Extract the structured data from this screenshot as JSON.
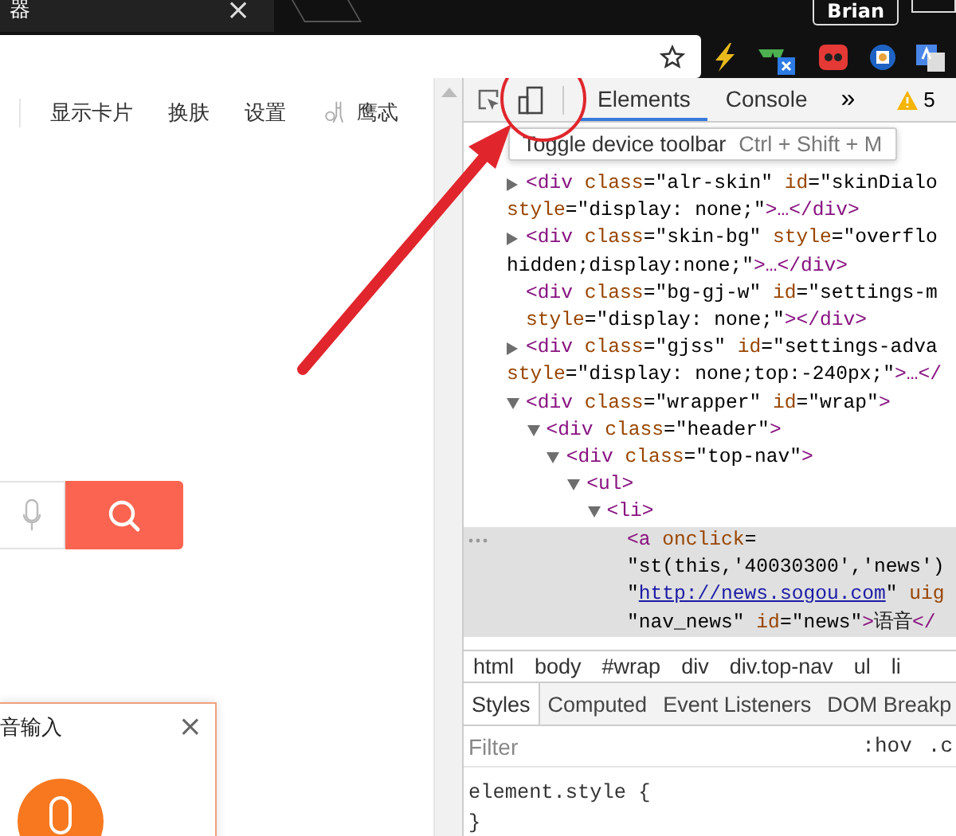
{
  "browser": {
    "tab_title": "器",
    "tab_close": "×",
    "profile_name": "Brian"
  },
  "page": {
    "nav": [
      "显示卡片",
      "换肤",
      "设置",
      "鹰忒"
    ],
    "voice_popup": {
      "title": "音输入",
      "close": "×"
    }
  },
  "devtools": {
    "tabs": [
      {
        "label": "Elements",
        "selected": true
      },
      {
        "label": "Console",
        "selected": false
      }
    ],
    "more": "»",
    "warning_count": "5",
    "tooltip": {
      "label": "Toggle device toolbar",
      "shortcut": "Ctrl + Shift + M"
    },
    "dom_tree": [
      {
        "expanded": false,
        "selected": false,
        "lines": [
          [
            {
              "kind": "tag",
              "text": "<div"
            },
            {
              "kind": "attr",
              "text": " class"
            },
            {
              "kind": "punct",
              "text": "="
            },
            {
              "kind": "value",
              "text": "\"alr-skin\""
            },
            {
              "kind": "attr",
              "text": " id"
            },
            {
              "kind": "punct",
              "text": "="
            },
            {
              "kind": "value",
              "text": "\"skinDialo"
            }
          ],
          [
            {
              "kind": "attr",
              "text": "style"
            },
            {
              "kind": "punct",
              "text": "="
            },
            {
              "kind": "value",
              "text": "\"display: none;\""
            },
            {
              "kind": "tag",
              "text": ">…</div>"
            }
          ]
        ]
      },
      {
        "expanded": false,
        "selected": false,
        "lines": [
          [
            {
              "kind": "tag",
              "text": "<div"
            },
            {
              "kind": "attr",
              "text": " class"
            },
            {
              "kind": "punct",
              "text": "="
            },
            {
              "kind": "value",
              "text": "\"skin-bg\""
            },
            {
              "kind": "attr",
              "text": " style"
            },
            {
              "kind": "punct",
              "text": "="
            },
            {
              "kind": "value",
              "text": "\"overflo"
            }
          ],
          [
            {
              "kind": "value",
              "text": "hidden;display:none;\""
            },
            {
              "kind": "tag",
              "text": ">…</div>"
            }
          ]
        ]
      },
      {
        "selected": false,
        "lines": [
          [
            {
              "kind": "tag",
              "text": "<div"
            },
            {
              "kind": "attr",
              "text": " class"
            },
            {
              "kind": "punct",
              "text": "="
            },
            {
              "kind": "value",
              "text": "\"bg-gj-w\""
            },
            {
              "kind": "attr",
              "text": " id"
            },
            {
              "kind": "punct",
              "text": "="
            },
            {
              "kind": "value",
              "text": "\"settings-m"
            }
          ],
          [
            {
              "kind": "attr",
              "text": "style"
            },
            {
              "kind": "punct",
              "text": "="
            },
            {
              "kind": "value",
              "text": "\"display: none;\""
            },
            {
              "kind": "tag",
              "text": "></div>"
            }
          ]
        ]
      },
      {
        "expanded": false,
        "selected": false,
        "lines": [
          [
            {
              "kind": "tag",
              "text": "<div"
            },
            {
              "kind": "attr",
              "text": " class"
            },
            {
              "kind": "punct",
              "text": "="
            },
            {
              "kind": "value",
              "text": "\"gjss\""
            },
            {
              "kind": "attr",
              "text": " id"
            },
            {
              "kind": "punct",
              "text": "="
            },
            {
              "kind": "value",
              "text": "\"settings-adva"
            }
          ],
          [
            {
              "kind": "attr",
              "text": "style"
            },
            {
              "kind": "punct",
              "text": "="
            },
            {
              "kind": "value",
              "text": "\"display: none;top:-240px;\""
            },
            {
              "kind": "tag",
              "text": ">…</"
            }
          ]
        ]
      },
      {
        "expanded": true,
        "selected": false,
        "lines": [
          [
            {
              "kind": "tag",
              "text": "<div"
            },
            {
              "kind": "attr",
              "text": " class"
            },
            {
              "kind": "punct",
              "text": "="
            },
            {
              "kind": "value",
              "text": "\"wrapper\""
            },
            {
              "kind": "attr",
              "text": " id"
            },
            {
              "kind": "punct",
              "text": "="
            },
            {
              "kind": "value",
              "text": "\"wrap\""
            },
            {
              "kind": "tag",
              "text": ">"
            }
          ]
        ],
        "children": [
          {
            "expanded": true,
            "selected": false,
            "lines": [
              [
                {
                  "kind": "tag",
                  "text": "<div"
                },
                {
                  "kind": "attr",
                  "text": " class"
                },
                {
                  "kind": "punct",
                  "text": "="
                },
                {
                  "kind": "value",
                  "text": "\"header\""
                },
                {
                  "kind": "tag",
                  "text": ">"
                }
              ]
            ],
            "children": [
              {
                "expanded": true,
                "selected": false,
                "lines": [
                  [
                    {
                      "kind": "tag",
                      "text": "<div"
                    },
                    {
                      "kind": "attr",
                      "text": " class"
                    },
                    {
                      "kind": "punct",
                      "text": "="
                    },
                    {
                      "kind": "value",
                      "text": "\"top-nav\""
                    },
                    {
                      "kind": "tag",
                      "text": ">"
                    }
                  ]
                ],
                "children": [
                  {
                    "expanded": true,
                    "selected": false,
                    "lines": [
                      [
                        {
                          "kind": "tag",
                          "text": "<ul>"
                        }
                      ]
                    ],
                    "children": [
                      {
                        "expanded": true,
                        "selected": false,
                        "lines": [
                          [
                            {
                              "kind": "tag",
                              "text": "<li>"
                            }
                          ]
                        ],
                        "children": [
                          {
                            "selected": true,
                            "lines": [
                              [
                                {
                                  "kind": "tag",
                                  "text": "<a"
                                },
                                {
                                  "kind": "attr",
                                  "text": " onclick"
                                },
                                {
                                  "kind": "punct",
                                  "text": "="
                                }
                              ],
                              [
                                {
                                  "kind": "value",
                                  "text": "\"st(this,'40030300','news')"
                                }
                              ],
                              [
                                {
                                  "kind": "value",
                                  "text": "\""
                                },
                                {
                                  "kind": "link",
                                  "text": "http://news.sogou.com"
                                },
                                {
                                  "kind": "value",
                                  "text": "\""
                                },
                                {
                                  "kind": "attr",
                                  "text": " uig"
                                }
                              ],
                              [
                                {
                                  "kind": "value",
                                  "text": "\"nav_news\""
                                },
                                {
                                  "kind": "attr",
                                  "text": " id"
                                },
                                {
                                  "kind": "punct",
                                  "text": "="
                                },
                                {
                                  "kind": "value",
                                  "text": "\"news\""
                                },
                                {
                                  "kind": "tag",
                                  "text": ">"
                                },
                                {
                                  "kind": "content",
                                  "text": "语音"
                                },
                                {
                                  "kind": "tag",
                                  "text": "</"
                                }
                              ]
                            ]
                          }
                        ]
                      }
                    ]
                  }
                ]
              }
            ]
          }
        ]
      }
    ],
    "breadcrumbs": [
      {
        "label": "html"
      },
      {
        "label": "body"
      },
      {
        "label": "#wrap"
      },
      {
        "label": "div"
      },
      {
        "label": "div.top-nav"
      },
      {
        "label": "ul"
      },
      {
        "label": "li"
      }
    ],
    "style_tabs": [
      {
        "label": "Styles",
        "selected": true
      },
      {
        "label": "Computed",
        "selected": false
      },
      {
        "label": "Event Listeners",
        "selected": false
      },
      {
        "label": "DOM Breakp",
        "selected": false
      }
    ],
    "filter": {
      "placeholder": "Filter"
    },
    "filter_buttons": [
      ":hov",
      ".c"
    ],
    "rules": [
      "element.style {",
      "}"
    ]
  }
}
